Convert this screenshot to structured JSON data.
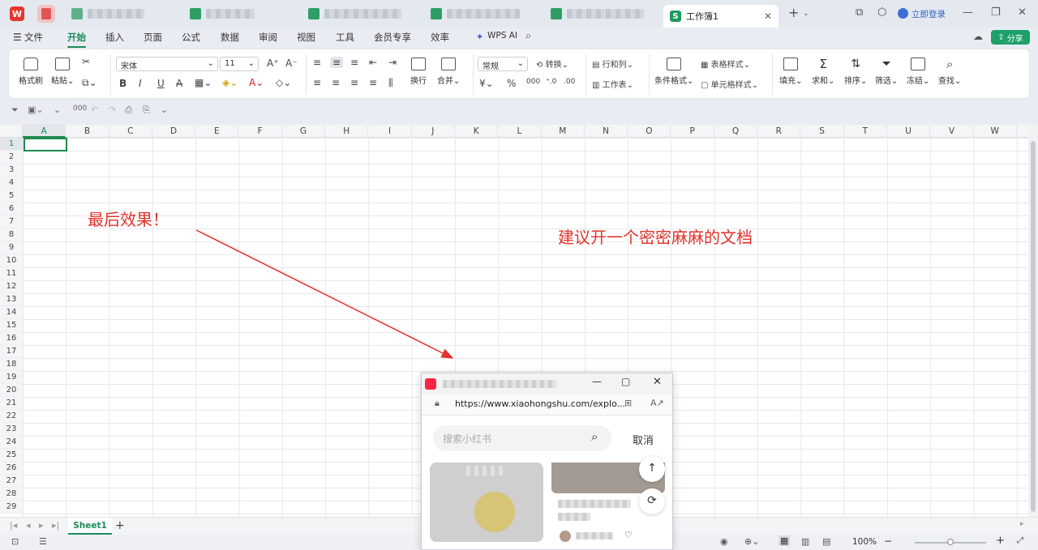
{
  "tabs": {
    "active_title": "工作簿1"
  },
  "titlebar": {
    "login": "立即登录"
  },
  "menu": [
    "文件",
    "开始",
    "插入",
    "页面",
    "公式",
    "数据",
    "审阅",
    "视图",
    "工具",
    "会员专享",
    "效率",
    "WPS AI"
  ],
  "share_label": "分享",
  "ribbon": {
    "format_painter": "格式刷",
    "paste": "粘贴",
    "font_name": "宋体",
    "font_size": "11",
    "wrap": "换行",
    "merge": "合并",
    "number_format": "常规",
    "convert": "转换",
    "row_col": "行和列",
    "worksheet": "工作表",
    "cond_format": "条件格式",
    "table_style": "表格样式",
    "cell_style": "单元格样式",
    "fill": "填充",
    "sum": "求和",
    "sort": "排序",
    "filter": "筛选",
    "freeze": "冻结",
    "find": "查找"
  },
  "columns": [
    "A",
    "B",
    "C",
    "D",
    "E",
    "F",
    "G",
    "H",
    "I",
    "J",
    "K",
    "L",
    "M",
    "N",
    "O",
    "P",
    "Q",
    "R",
    "S",
    "T",
    "U",
    "V",
    "W"
  ],
  "rows": [
    "1",
    "2",
    "3",
    "4",
    "5",
    "6",
    "7",
    "8",
    "9",
    "10",
    "11",
    "12",
    "13",
    "14",
    "15",
    "16",
    "17",
    "18",
    "19",
    "20",
    "21",
    "22",
    "23",
    "24",
    "25",
    "26",
    "27",
    "28",
    "29"
  ],
  "annotations": {
    "left": "最后效果！",
    "right": "建议开一个密密麻麻的文档"
  },
  "sheet_tab": "Sheet1",
  "zoom": "100%",
  "popup": {
    "url": "https://www.xiaohongshu.com/explo...",
    "search_placeholder": "搜索小红书",
    "cancel": "取消"
  },
  "colors": {
    "accent": "#1a8a5a",
    "annotation": "#e0332c"
  }
}
